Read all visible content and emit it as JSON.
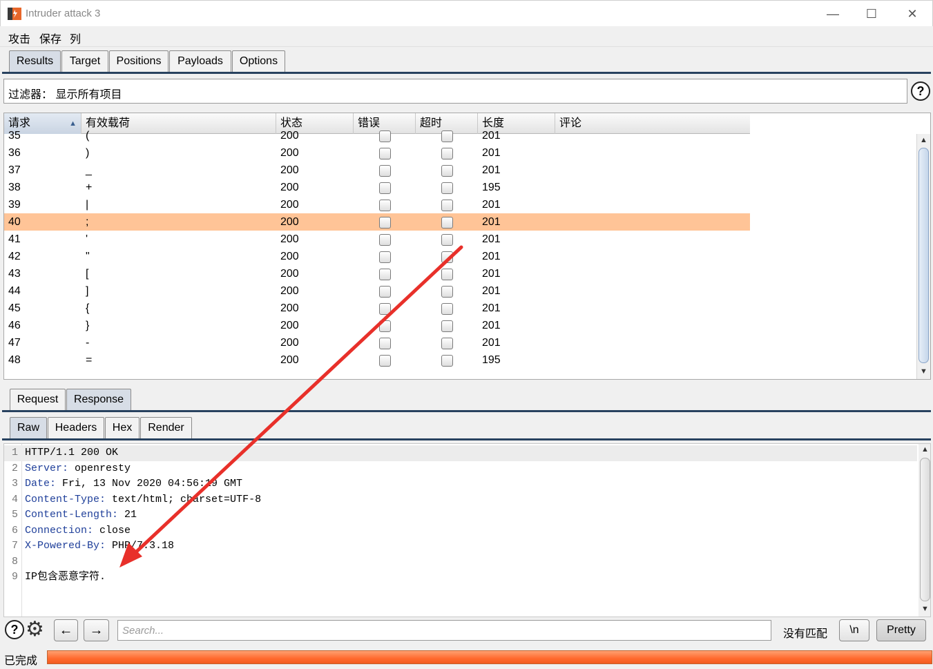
{
  "window": {
    "title": "Intruder attack 3",
    "minimize": "—",
    "maximize": "☐",
    "close": "✕"
  },
  "menu": [
    "攻击",
    "保存",
    "列"
  ],
  "main_tabs": [
    "Results",
    "Target",
    "Positions",
    "Payloads",
    "Options"
  ],
  "filter": {
    "text": "过滤器： 显示所有项目"
  },
  "help_glyph": "?",
  "table": {
    "columns": [
      "请求",
      "有效载荷",
      "状态",
      "错误",
      "超时",
      "长度",
      "评论"
    ],
    "sorted_column": "请求",
    "selected_request": "40",
    "rows": [
      {
        "request": "35",
        "payload": "(",
        "status": "200",
        "length": "201"
      },
      {
        "request": "36",
        "payload": ")",
        "status": "200",
        "length": "201"
      },
      {
        "request": "37",
        "payload": "_",
        "status": "200",
        "length": "201"
      },
      {
        "request": "38",
        "payload": "+",
        "status": "200",
        "length": "195"
      },
      {
        "request": "39",
        "payload": "|",
        "status": "200",
        "length": "201"
      },
      {
        "request": "40",
        "payload": ";",
        "status": "200",
        "length": "201"
      },
      {
        "request": "41",
        "payload": "'",
        "status": "200",
        "length": "201"
      },
      {
        "request": "42",
        "payload": "\"",
        "status": "200",
        "length": "201"
      },
      {
        "request": "43",
        "payload": "[",
        "status": "200",
        "length": "201"
      },
      {
        "request": "44",
        "payload": "]",
        "status": "200",
        "length": "201"
      },
      {
        "request": "45",
        "payload": "{",
        "status": "200",
        "length": "201"
      },
      {
        "request": "46",
        "payload": "}",
        "status": "200",
        "length": "201"
      },
      {
        "request": "47",
        "payload": "-",
        "status": "200",
        "length": "201"
      },
      {
        "request": "48",
        "payload": "=",
        "status": "200",
        "length": "195"
      }
    ]
  },
  "message_tabs": [
    "Request",
    "Response"
  ],
  "view_tabs": [
    "Raw",
    "Headers",
    "Hex",
    "Render"
  ],
  "response": {
    "lines": [
      {
        "num": "1",
        "key": "",
        "value": "HTTP/1.1 200 OK"
      },
      {
        "num": "2",
        "key": "Server:",
        "value": " openresty"
      },
      {
        "num": "3",
        "key": "Date:",
        "value": " Fri, 13 Nov 2020 04:56:19 GMT"
      },
      {
        "num": "4",
        "key": "Content-Type:",
        "value": " text/html; charset=UTF-8"
      },
      {
        "num": "5",
        "key": "Content-Length:",
        "value": " 21"
      },
      {
        "num": "6",
        "key": "Connection:",
        "value": " close"
      },
      {
        "num": "7",
        "key": "X-Powered-By:",
        "value": " PHP/7.3.18"
      },
      {
        "num": "8",
        "key": "",
        "value": ""
      },
      {
        "num": "9",
        "key": "",
        "value": "IP包含恶意字符."
      }
    ]
  },
  "search": {
    "placeholder": "Search...",
    "match_status": "没有匹配",
    "newline_button": "\\n",
    "pretty_button": "Pretty",
    "prev_glyph": "←",
    "next_glyph": "→",
    "settings_glyph": "⚙"
  },
  "status": {
    "text": "已完成",
    "progress_fraction": 1.0
  },
  "annotation_color": "#e8302a",
  "accent_color": "#28425f"
}
